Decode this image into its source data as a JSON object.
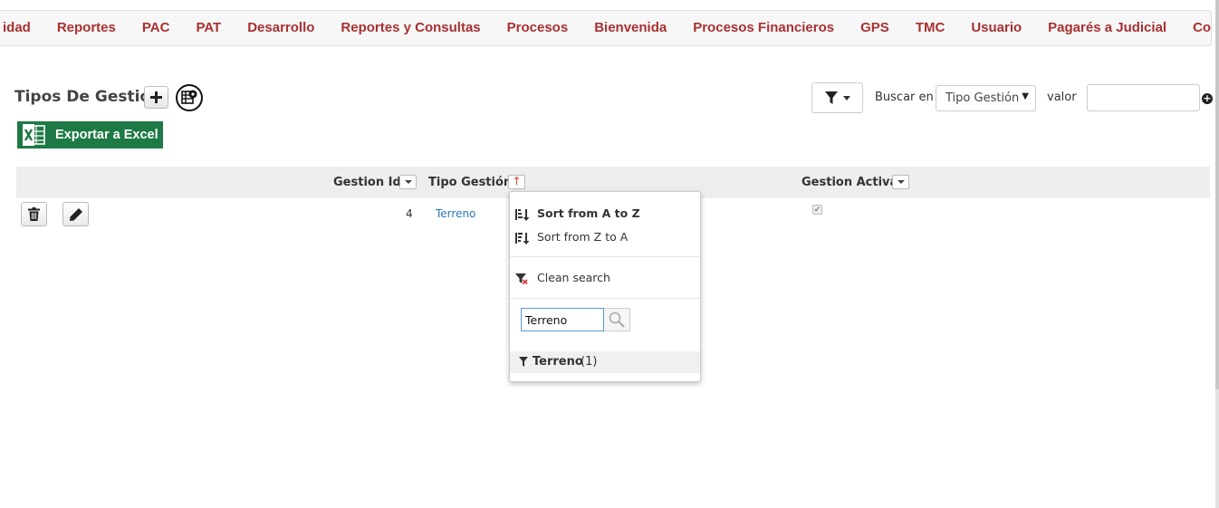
{
  "nav": {
    "items": [
      "idad",
      "Reportes",
      "PAC",
      "PAT",
      "Desarrollo",
      "Reportes y Consultas",
      "Procesos",
      "Bienvenida",
      "Procesos Financieros",
      "GPS",
      "TMC",
      "Usuario",
      "Pagarés a Judicial",
      "Contabilidad"
    ]
  },
  "page": {
    "title": "Tipos De Gestión",
    "export_label": "Exportar a Excel"
  },
  "filters": {
    "buscar_label": "Buscar en",
    "buscar_value": "Tipo Gestión",
    "valor_label": "valor",
    "valor_value": ""
  },
  "grid": {
    "columns": [
      "Gestion Id",
      "Tipo Gestión",
      "Gestion Activa"
    ],
    "rows": [
      {
        "id": "4",
        "tipo": "Terreno",
        "activa": true
      }
    ]
  },
  "popup": {
    "sort_az": "Sort from A to Z",
    "sort_za": "Sort from Z to A",
    "clean": "Clean search",
    "search_value": "Terreno",
    "result_name": "Terreno",
    "result_count": "(1)"
  },
  "colors": {
    "nav_text": "#a83030",
    "excel_green": "#1e7a45",
    "link_blue": "#2a78b8"
  }
}
